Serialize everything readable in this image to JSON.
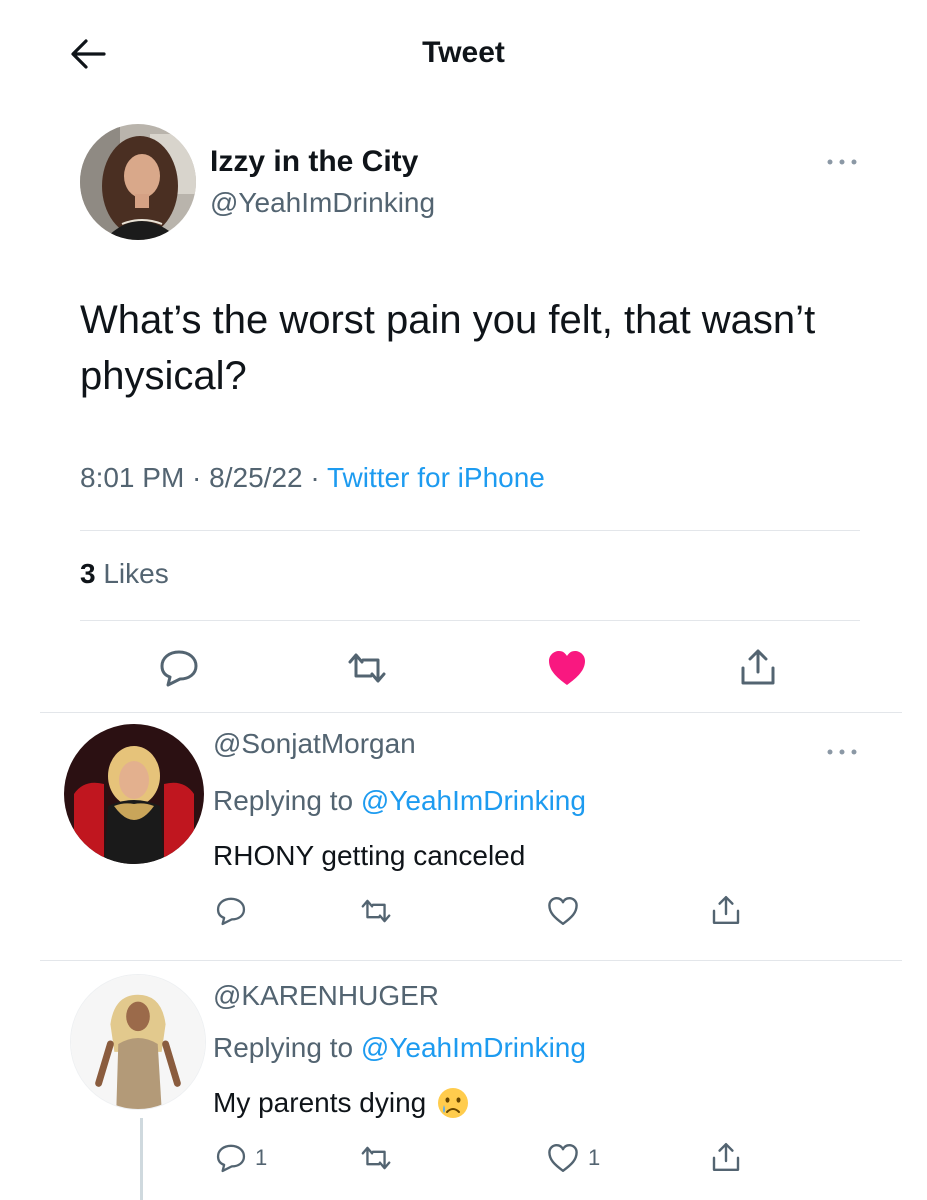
{
  "header": {
    "title": "Tweet",
    "back_icon": "back-arrow-icon"
  },
  "tweet": {
    "author_name": "Izzy in the City",
    "author_handle": "@YeahImDrinking",
    "text": "What’s the worst pain you felt, that wasn’t physical?",
    "time": "8:01 PM",
    "date": "8/25/22",
    "separator": " · ",
    "source": "Twitter for iPhone",
    "likes_count": "3",
    "likes_label": "Likes",
    "liked": true,
    "colors": {
      "accent": "#1d9bf0",
      "like": "#f91880",
      "muted": "#536471"
    }
  },
  "replies": [
    {
      "handle": "@SonjatMorgan",
      "replying_prefix": "Replying to ",
      "replying_to": "@YeahImDrinking",
      "text": "RHONY getting canceled",
      "reply_count": "",
      "like_count": ""
    },
    {
      "handle": "@KARENHUGER",
      "replying_prefix": "Replying to ",
      "replying_to": "@YeahImDrinking",
      "text": "My parents dying",
      "emoji": "crying-face-emoji",
      "reply_count": "1",
      "like_count": "1"
    }
  ]
}
